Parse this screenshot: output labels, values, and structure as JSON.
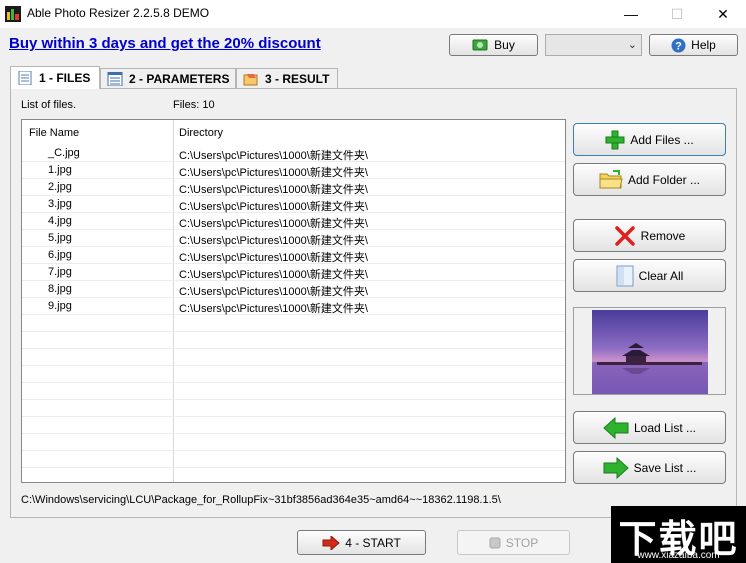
{
  "window": {
    "title": "Able Photo Resizer 2.2.5.8 DEMO",
    "minimize": "—",
    "maximize": "☐",
    "close": "✕"
  },
  "promo": {
    "text": "Buy within 3 days and get the 20% discount"
  },
  "toolbar": {
    "buy_label": "Buy",
    "help_label": "Help",
    "combo_value": ""
  },
  "tabs": [
    {
      "label": "1 - FILES",
      "active": true
    },
    {
      "label": "2 - PARAMETERS",
      "active": false
    },
    {
      "label": "3 - RESULT",
      "active": false
    }
  ],
  "files": {
    "list_label": "List of files.",
    "count_label": "Files: 10",
    "columns": {
      "name": "File Name",
      "directory": "Directory"
    },
    "rows": [
      {
        "name": "_C.jpg",
        "directory": "C:\\Users\\pc\\Pictures\\1000\\新建文件夹\\"
      },
      {
        "name": "1.jpg",
        "directory": "C:\\Users\\pc\\Pictures\\1000\\新建文件夹\\"
      },
      {
        "name": "2.jpg",
        "directory": "C:\\Users\\pc\\Pictures\\1000\\新建文件夹\\"
      },
      {
        "name": "3.jpg",
        "directory": "C:\\Users\\pc\\Pictures\\1000\\新建文件夹\\"
      },
      {
        "name": "4.jpg",
        "directory": "C:\\Users\\pc\\Pictures\\1000\\新建文件夹\\"
      },
      {
        "name": "5.jpg",
        "directory": "C:\\Users\\pc\\Pictures\\1000\\新建文件夹\\"
      },
      {
        "name": "6.jpg",
        "directory": "C:\\Users\\pc\\Pictures\\1000\\新建文件夹\\"
      },
      {
        "name": "7.jpg",
        "directory": "C:\\Users\\pc\\Pictures\\1000\\新建文件夹\\"
      },
      {
        "name": "8.jpg",
        "directory": "C:\\Users\\pc\\Pictures\\1000\\新建文件夹\\"
      },
      {
        "name": "9.jpg",
        "directory": "C:\\Users\\pc\\Pictures\\1000\\新建文件夹\\"
      },
      {
        "name": "",
        "directory": ""
      },
      {
        "name": "",
        "directory": ""
      },
      {
        "name": "",
        "directory": ""
      },
      {
        "name": "",
        "directory": ""
      },
      {
        "name": "",
        "directory": ""
      },
      {
        "name": "",
        "directory": ""
      },
      {
        "name": "",
        "directory": ""
      },
      {
        "name": "",
        "directory": ""
      },
      {
        "name": "",
        "directory": ""
      },
      {
        "name": "",
        "directory": ""
      }
    ]
  },
  "side_buttons": {
    "add_files": "Add Files ...",
    "add_folder": "Add Folder ...",
    "remove": "Remove",
    "clear_all": "Clear All",
    "load_list": "Load List ...",
    "save_list": "Save List ..."
  },
  "status": {
    "path": "C:\\Windows\\servicing\\LCU\\Package_for_RollupFix~31bf3856ad364e35~amd64~~18362.1198.1.5\\"
  },
  "actions": {
    "start": "4 - START",
    "stop": "STOP"
  },
  "watermark": {
    "text": "下载吧",
    "url": "www.xiazaiba.com"
  },
  "colors": {
    "promo_link": "#0000cc",
    "arrow_green": "#2db32d",
    "remove_red": "#e02020",
    "start_red": "#d42a1a"
  },
  "icons": {
    "app": "app-icon",
    "buy": "money-icon",
    "help": "help-icon",
    "tab1": "list-icon",
    "tab2": "parameters-icon",
    "tab3": "result-icon",
    "add_files": "plus-icon",
    "add_folder": "folder-icon",
    "remove": "x-icon",
    "clear_all": "blank-page-icon",
    "load_list": "arrow-left-icon",
    "save_list": "arrow-right-icon",
    "start": "arrow-right-icon",
    "stop": "stop-icon"
  }
}
